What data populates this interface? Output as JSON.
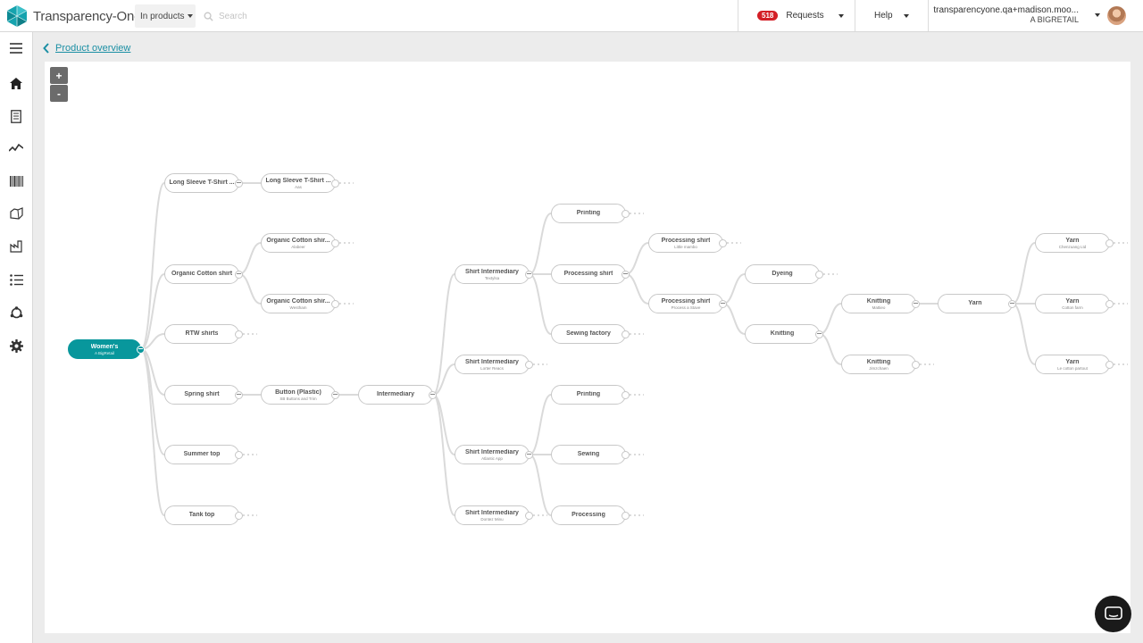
{
  "app": {
    "name": "Transparency-One"
  },
  "header": {
    "scope_select": "In products",
    "search_placeholder": "Search",
    "requests": {
      "count": "518",
      "label": "Requests"
    },
    "help_label": "Help",
    "user": {
      "email": "transparencyone.qa+madison.moo...",
      "org": "A BIGRETAIL"
    }
  },
  "sidebar": {
    "items": [
      {
        "name": "menu-icon"
      },
      {
        "name": "home-icon"
      },
      {
        "name": "document-icon"
      },
      {
        "name": "activity-icon"
      },
      {
        "name": "barcode-icon"
      },
      {
        "name": "products-icon"
      },
      {
        "name": "factory-icon"
      },
      {
        "name": "list-icon"
      },
      {
        "name": "network-icon"
      },
      {
        "name": "gear-icon"
      }
    ]
  },
  "breadcrumb": {
    "label": "Product overview"
  },
  "zoom": {
    "in": "+",
    "out": "-"
  },
  "tree": {
    "nodes": [
      {
        "id": "root",
        "name": "Women's",
        "sub": "A BigRetail",
        "root": true
      },
      {
        "id": "ls1",
        "name": "Long Sleeve T-Shirt ...",
        "sub": "",
        "parent": "root"
      },
      {
        "id": "ls2",
        "name": "Long Sleeve T-Shirt ...",
        "sub": "Aas",
        "parent": "ls1"
      },
      {
        "id": "oc1",
        "name": "Organic Cotton shirt",
        "sub": "",
        "parent": "root"
      },
      {
        "id": "oc2",
        "name": "Organic Cotton shir...",
        "sub": "Alabeer",
        "parent": "oc1"
      },
      {
        "id": "oc3",
        "name": "Organic Cotton shir...",
        "sub": "Westham",
        "parent": "oc1"
      },
      {
        "id": "rtw",
        "name": "RTW shirts",
        "sub": "",
        "parent": "root"
      },
      {
        "id": "spring",
        "name": "Spring shirt",
        "sub": "",
        "parent": "root"
      },
      {
        "id": "button",
        "name": "Button (Plastic)",
        "sub": "SB Buttons and Trim",
        "parent": "spring"
      },
      {
        "id": "inter",
        "name": "Intermediary",
        "sub": "",
        "parent": "button"
      },
      {
        "id": "si1",
        "name": "Shirt Intermediary",
        "sub": "Textylsa",
        "parent": "inter"
      },
      {
        "id": "print1",
        "name": "Printing",
        "sub": "",
        "parent": "si1"
      },
      {
        "id": "proc1",
        "name": "Processing shirt",
        "sub": "",
        "parent": "si1"
      },
      {
        "id": "psA",
        "name": "Processing shirt",
        "sub": "Little mambo",
        "parent": "proc1"
      },
      {
        "id": "psB",
        "name": "Processing shirt",
        "sub": "Process a Stave",
        "parent": "proc1"
      },
      {
        "id": "dye",
        "name": "Dyeing",
        "sub": "",
        "parent": "psB"
      },
      {
        "id": "knit",
        "name": "Knitting",
        "sub": "",
        "parent": "psB"
      },
      {
        "id": "knitA",
        "name": "Knitting",
        "sub": "Mattieo",
        "parent": "knit"
      },
      {
        "id": "knitB",
        "name": "Knitting",
        "sub": "Jimzchaen",
        "parent": "knit"
      },
      {
        "id": "yarn",
        "name": "Yarn",
        "sub": "",
        "parent": "knitA"
      },
      {
        "id": "yarnA",
        "name": "Yarn",
        "sub": "Chenzuang Ltd",
        "parent": "yarn"
      },
      {
        "id": "yarnB",
        "name": "Yarn",
        "sub": "Cotton farm",
        "parent": "yarn"
      },
      {
        "id": "yarnC",
        "name": "Yarn",
        "sub": "Le cotton partout",
        "parent": "yarn"
      },
      {
        "id": "sew1",
        "name": "Sewing factory",
        "sub": "",
        "parent": "si1"
      },
      {
        "id": "si2",
        "name": "Shirt Intermediary",
        "sub": "Lorter Reacs",
        "parent": "inter"
      },
      {
        "id": "si3",
        "name": "Shirt Intermediary",
        "sub": "Atlantic App",
        "parent": "inter"
      },
      {
        "id": "print2",
        "name": "Printing",
        "sub": "",
        "parent": "si3"
      },
      {
        "id": "sew2",
        "name": "Sewing",
        "sub": "",
        "parent": "si3"
      },
      {
        "id": "proc2",
        "name": "Processing",
        "sub": "",
        "parent": "si3"
      },
      {
        "id": "si4",
        "name": "Shirt Intermediary",
        "sub": "Dontez Minu",
        "parent": "inter"
      },
      {
        "id": "summer",
        "name": "Summer top",
        "sub": "",
        "parent": "root"
      },
      {
        "id": "tank",
        "name": "Tank top",
        "sub": "",
        "parent": "root"
      }
    ]
  }
}
